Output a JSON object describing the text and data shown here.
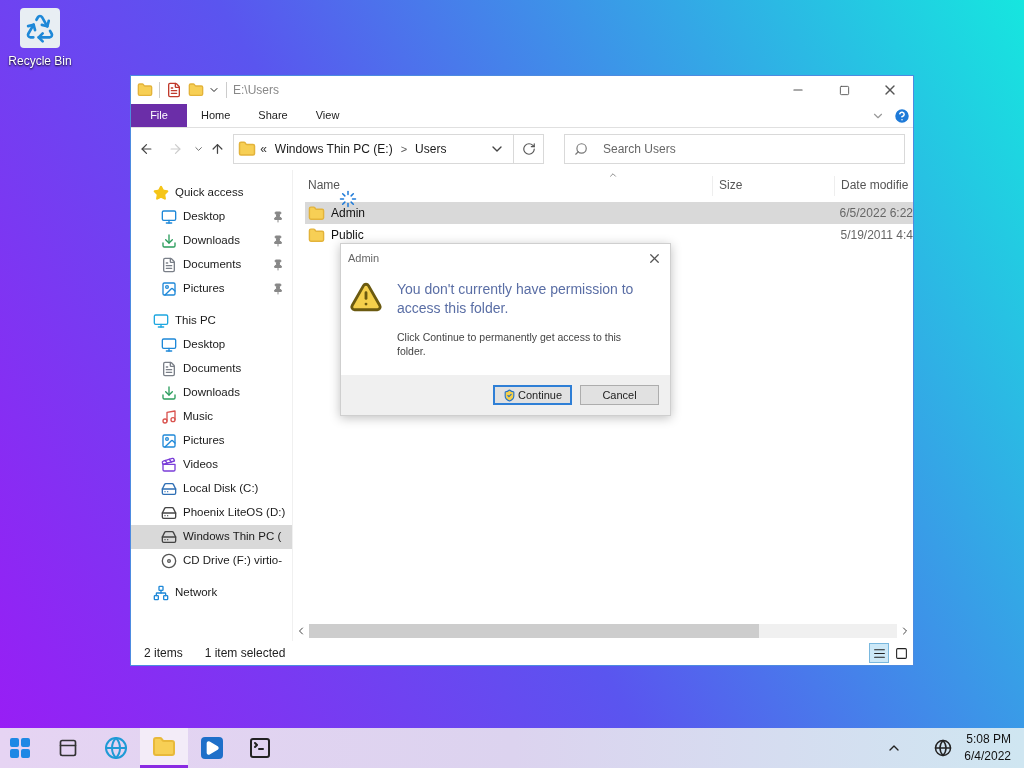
{
  "desktop": {
    "icons": [
      {
        "label": "Recycle Bin"
      }
    ]
  },
  "window": {
    "title": "E:\\Users"
  },
  "ribbon": {
    "tabs": [
      {
        "label": "File",
        "kind": "file",
        "selected": false
      },
      {
        "label": "Home",
        "kind": "tab",
        "selected": false
      },
      {
        "label": "Share",
        "kind": "tab",
        "selected": false
      },
      {
        "label": "View",
        "kind": "tab",
        "selected": false
      }
    ]
  },
  "navigation": {
    "back_disabled": false,
    "forward_disabled": true
  },
  "address": {
    "overflow": "«",
    "path": [
      "Windows Thin PC (E:)",
      "Users"
    ],
    "separator": ">"
  },
  "search": {
    "placeholder": "Search Users"
  },
  "sidebar": {
    "items": [
      {
        "label": "Quick access",
        "kind": "star",
        "selected": false,
        "children": [
          {
            "label": "Desktop",
            "kind": "desktop",
            "pinned": true,
            "selected": false
          },
          {
            "label": "Downloads",
            "kind": "downloads",
            "pinned": true,
            "selected": false
          },
          {
            "label": "Documents",
            "kind": "documents",
            "pinned": true,
            "selected": false
          },
          {
            "label": "Pictures",
            "kind": "pictures",
            "pinned": true,
            "selected": false
          }
        ]
      },
      {
        "label": "This PC",
        "kind": "pc",
        "selected": false,
        "children": [
          {
            "label": "Desktop",
            "kind": "desktop",
            "selected": false
          },
          {
            "label": "Documents",
            "kind": "documents",
            "selected": false
          },
          {
            "label": "Downloads",
            "kind": "downloads",
            "selected": false
          },
          {
            "label": "Music",
            "kind": "music",
            "selected": false
          },
          {
            "label": "Pictures",
            "kind": "pictures",
            "selected": false
          },
          {
            "label": "Videos",
            "kind": "videos",
            "selected": false
          },
          {
            "label": "Local Disk (C:)",
            "kind": "localdisk",
            "selected": false
          },
          {
            "label": "Phoenix LiteOS (D:)",
            "kind": "drive",
            "selected": false
          },
          {
            "label": "Windows Thin PC (",
            "kind": "drive",
            "selected": true
          },
          {
            "label": "CD Drive (F:) virtio-",
            "kind": "cd",
            "selected": false
          }
        ]
      },
      {
        "label": "Network",
        "kind": "network",
        "selected": false
      }
    ]
  },
  "table": {
    "columns": [
      "Name",
      "Size",
      "Date modifie"
    ],
    "rows": [
      {
        "name": "Admin",
        "size": "",
        "date": "6/5/2022 6:22",
        "selected": true
      },
      {
        "name": "Public",
        "size": "",
        "date": "5/19/2011 4:4",
        "selected": false
      }
    ]
  },
  "status_bar": {
    "items": [
      "2 items",
      "1 item selected"
    ],
    "views": [
      {
        "kind": "details",
        "selected": true
      },
      {
        "kind": "large",
        "selected": false
      }
    ]
  },
  "dialog": {
    "title": "Admin",
    "heading": "You don't currently have permission to access this folder.",
    "body": "Click Continue to permanently get access to this folder.",
    "buttons": [
      {
        "label": "Continue",
        "kind": "shield",
        "default": true
      },
      {
        "label": "Cancel",
        "kind": "plain",
        "default": false
      }
    ]
  },
  "taskbar": {
    "apps": [
      {
        "kind": "start",
        "selected": false
      },
      {
        "kind": "taskview",
        "selected": false
      },
      {
        "kind": "browser",
        "selected": false
      },
      {
        "kind": "explorer",
        "selected": true
      },
      {
        "kind": "media",
        "selected": false
      },
      {
        "kind": "terminal",
        "selected": false
      }
    ],
    "time": "5:08 PM",
    "date": "6/4/2022"
  }
}
